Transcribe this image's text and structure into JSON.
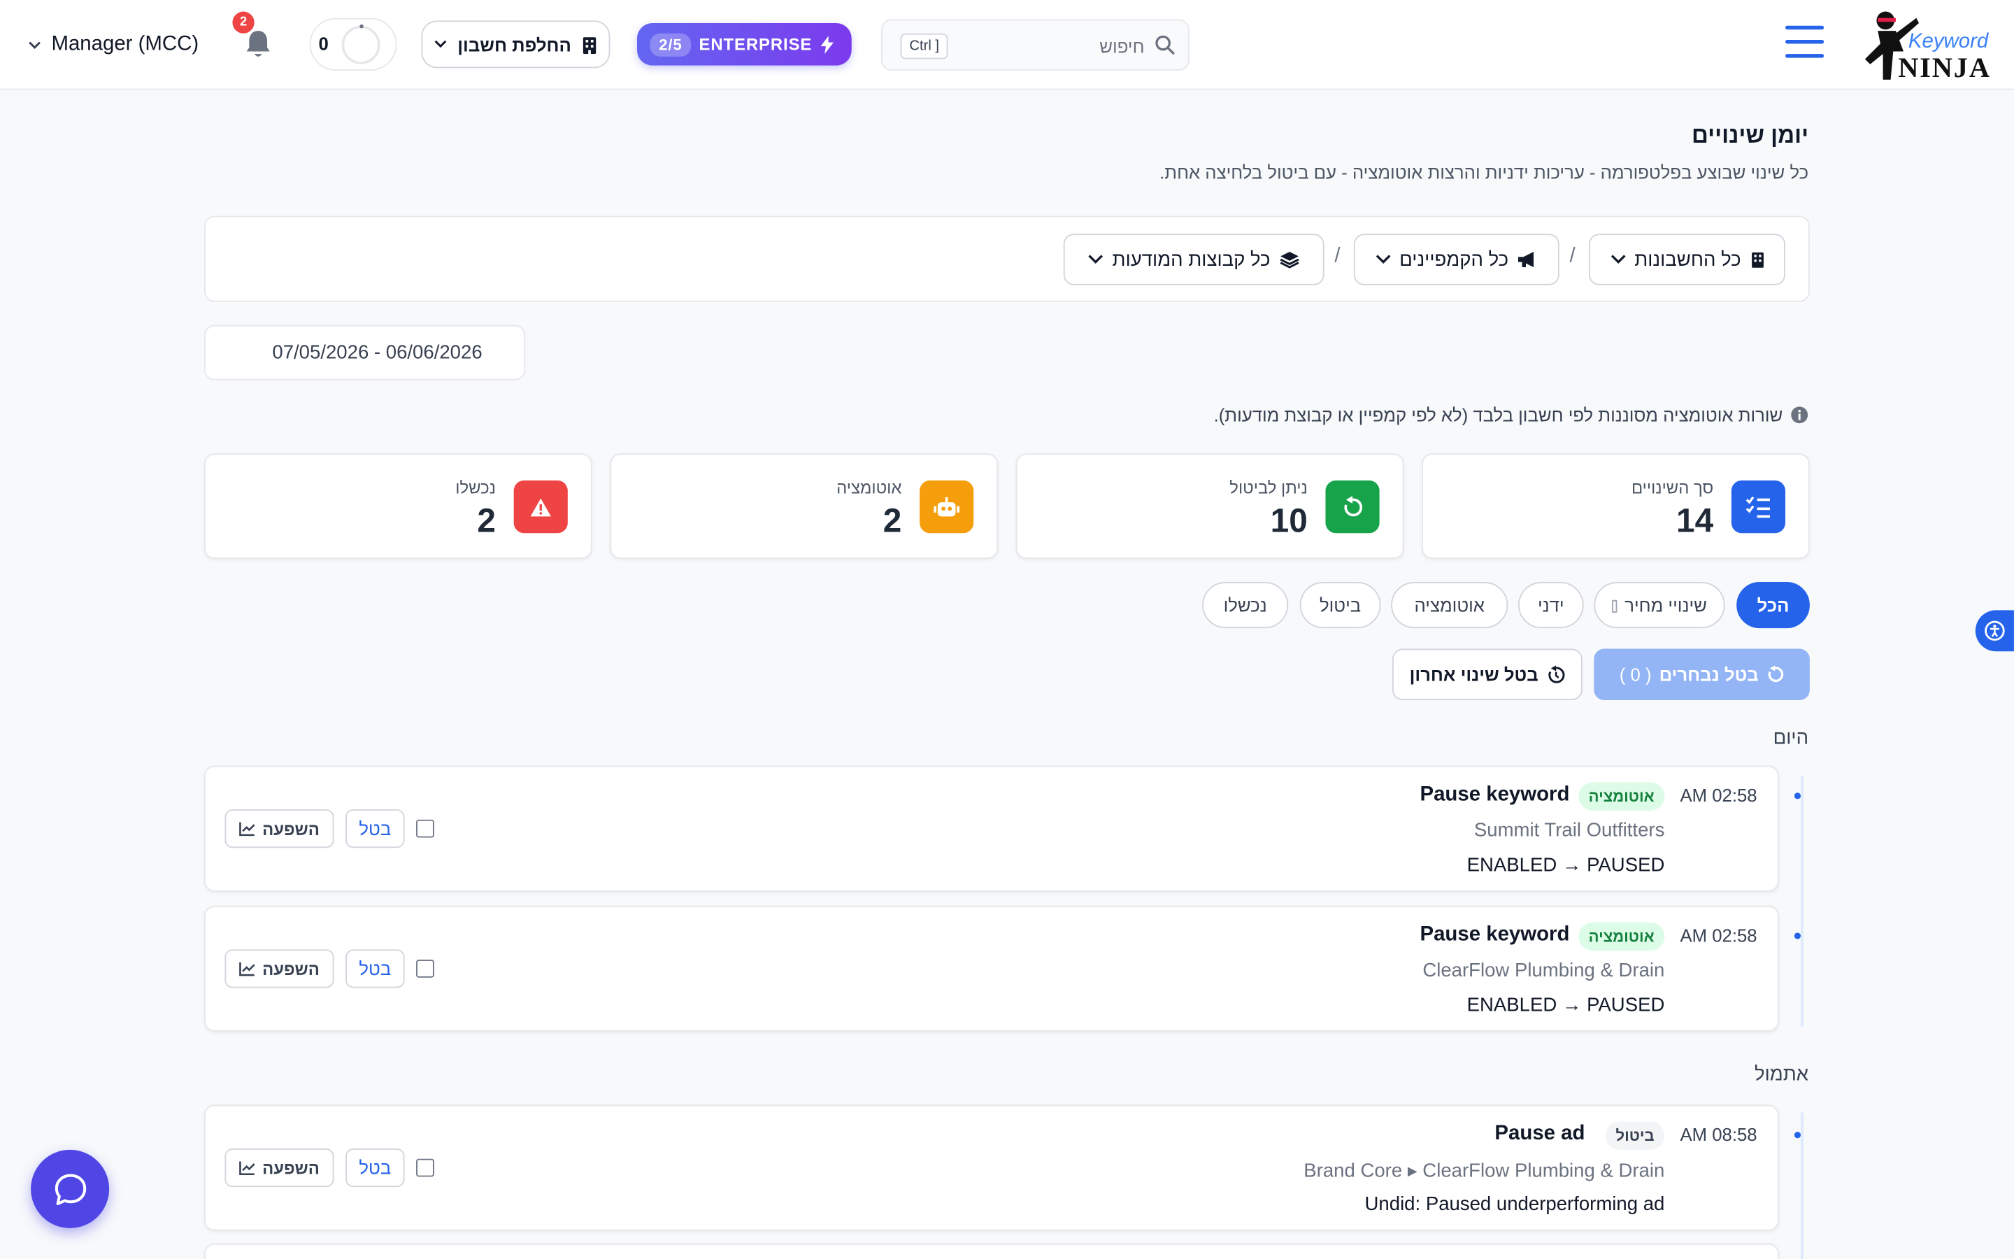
{
  "header": {
    "logo_line1": "Keyword",
    "logo_line2": "NINJA",
    "search_placeholder": "חיפוש",
    "search_shortcut": "Ctrl ]",
    "plan_badge": "ENTERPRISE",
    "plan_fraction": "2/5",
    "switch_account": "החלפת חשבון",
    "counter_value": "0",
    "notifications_count": "2",
    "manager_label": "Manager (MCC)"
  },
  "page": {
    "title": "יומן שינויים",
    "subtitle": "כל שינוי שבוצע בפלטפורמה - עריכות ידניות והרצות אוטומציה - עם ביטול בלחיצה אחת."
  },
  "filters": {
    "accounts": "כל החשבונות",
    "campaigns": "כל הקמפיינים",
    "ad_groups": "כל קבוצות המודעות",
    "separator": "/",
    "date_range": "07/05/2026 - 06/06/2026"
  },
  "info_note": "שורות אוטומציה מסוננות לפי חשבון בלבד (לא לפי קמפיין או קבוצת מודעות).",
  "stats": {
    "total": {
      "label": "סך השינויים",
      "value": "14",
      "color": "#2563eb"
    },
    "undoable": {
      "label": "ניתן לביטול",
      "value": "10",
      "color": "#16a34a"
    },
    "automation": {
      "label": "אוטומציה",
      "value": "2",
      "color": "#f59e0b"
    },
    "failed": {
      "label": "נכשלו",
      "value": "2",
      "color": "#ef4444"
    }
  },
  "tabs": {
    "all": "הכל",
    "price": "שינויי מחיר",
    "manual": "ידני",
    "automation": "אוטומציה",
    "cancel": "ביטול",
    "failed": "נכשלו"
  },
  "bulk": {
    "undo_selected": "בטל נבחרים",
    "selected_count": "( 0 )",
    "undo_last": "בטל שינוי אחרון"
  },
  "groups": {
    "today": "היום",
    "yesterday": "אתמול"
  },
  "entries": [
    {
      "time": "AM 02:58",
      "tag": "אוטומציה",
      "action": "Pause keyword",
      "account": "Summit Trail Outfitters",
      "change": "ENABLED → PAUSED",
      "undo": "בטל",
      "impact": "השפעה"
    },
    {
      "time": "AM 02:58",
      "tag": "אוטומציה",
      "action": "Pause keyword",
      "account": "ClearFlow Plumbing & Drain",
      "change": "ENABLED → PAUSED",
      "undo": "בטל",
      "impact": "השפעה"
    },
    {
      "time": "AM 08:58",
      "tag": "ביטול",
      "action": "Pause ad",
      "account": "Brand Core ▸ ClearFlow Plumbing & Drain",
      "change": "Undid: Paused underperforming ad",
      "undo": "בטל",
      "impact": "השפעה"
    }
  ],
  "colors": {
    "accent": "#2563eb",
    "automation_tag_bg": "#dcfce7",
    "automation_tag_text": "#15803d"
  }
}
